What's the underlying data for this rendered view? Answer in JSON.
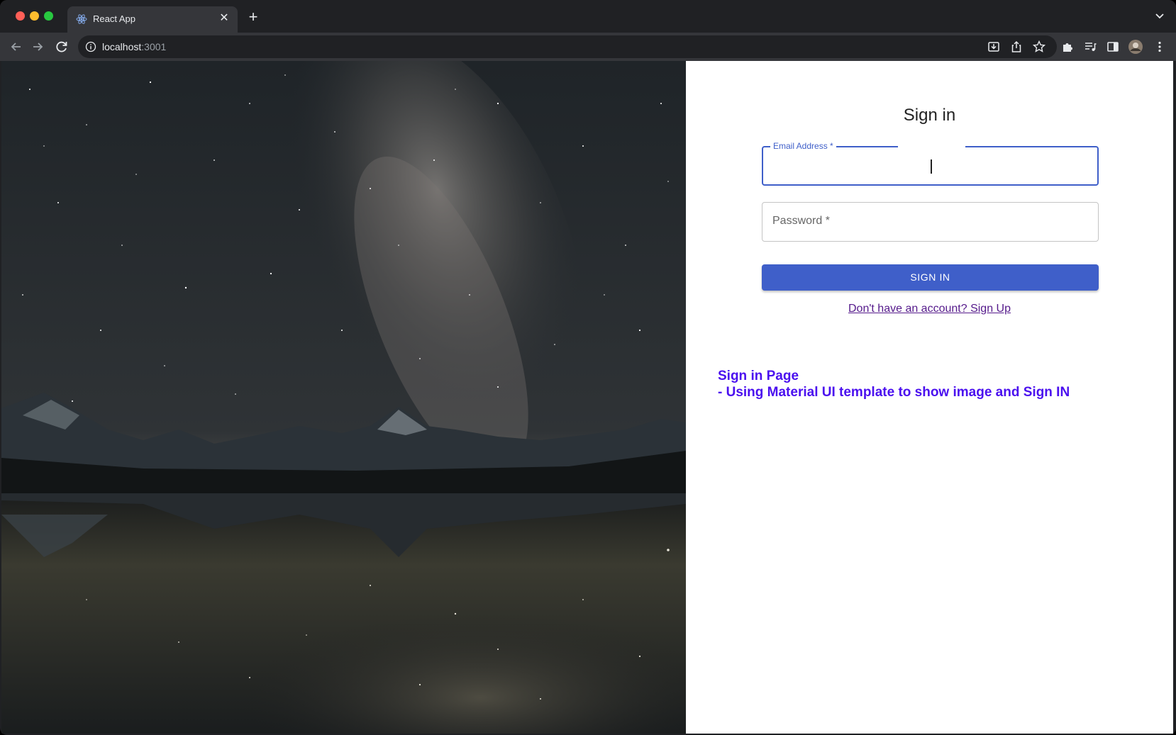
{
  "browser": {
    "tab_title": "React App",
    "url_host": "localhost",
    "url_port": ":3001"
  },
  "page": {
    "title": "Sign in",
    "email_label": "Email Address *",
    "password_label": "Password *",
    "signin_button": "SIGN IN",
    "signup_link": "Don't have an account? Sign Up",
    "note_line1": "Sign in Page",
    "note_line2": "- Using Material UI template to show image and Sign IN"
  },
  "colors": {
    "primary": "#3f5fc9",
    "note": "#4b10ef",
    "link": "#551a8b"
  },
  "icons": [
    "react-icon",
    "close-icon",
    "plus-icon",
    "back-icon",
    "forward-icon",
    "reload-icon",
    "info-icon",
    "install-icon",
    "share-icon",
    "star-icon",
    "extensions-icon",
    "media-icon",
    "sidepanel-icon",
    "avatar",
    "menu-icon"
  ]
}
